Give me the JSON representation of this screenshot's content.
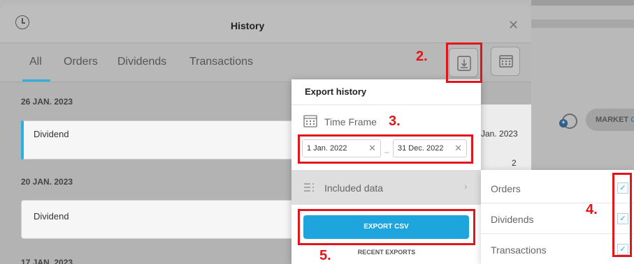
{
  "window": {
    "title": "History"
  },
  "tabs": [
    {
      "label": "All"
    },
    {
      "label": "Orders"
    },
    {
      "label": "Dividends"
    },
    {
      "label": "Transactions"
    }
  ],
  "history": [
    {
      "date": "26 JAN. 2023",
      "item": "Dividend"
    },
    {
      "date": "20 JAN. 2023",
      "item": "Dividend"
    },
    {
      "date": "17 JAN. 2023"
    }
  ],
  "behind": {
    "date_fragment": "Jan. 2023",
    "count": "2"
  },
  "export": {
    "title": "Export history",
    "time_frame_label": "Time Frame",
    "date_from": "1 Jan. 2022",
    "date_to": "31 Dec. 2022",
    "date_separator": "–",
    "included_label": "Included data",
    "button_label": "EXPORT CSV",
    "recent_label": "RECENT EXPORTS"
  },
  "included_options": [
    {
      "label": "Orders",
      "checked": true
    },
    {
      "label": "Dividends",
      "checked": true
    },
    {
      "label": "Transactions",
      "checked": true
    }
  ],
  "background": {
    "pill_text_a": "MARKET",
    "pill_text_b": "O"
  },
  "steps": {
    "s2": "2.",
    "s3": "3.",
    "s4": "4.",
    "s5": "5."
  },
  "colors": {
    "accent": "#2bb0e0",
    "annotation": "#e0161b",
    "export_button": "#1fa5de"
  }
}
